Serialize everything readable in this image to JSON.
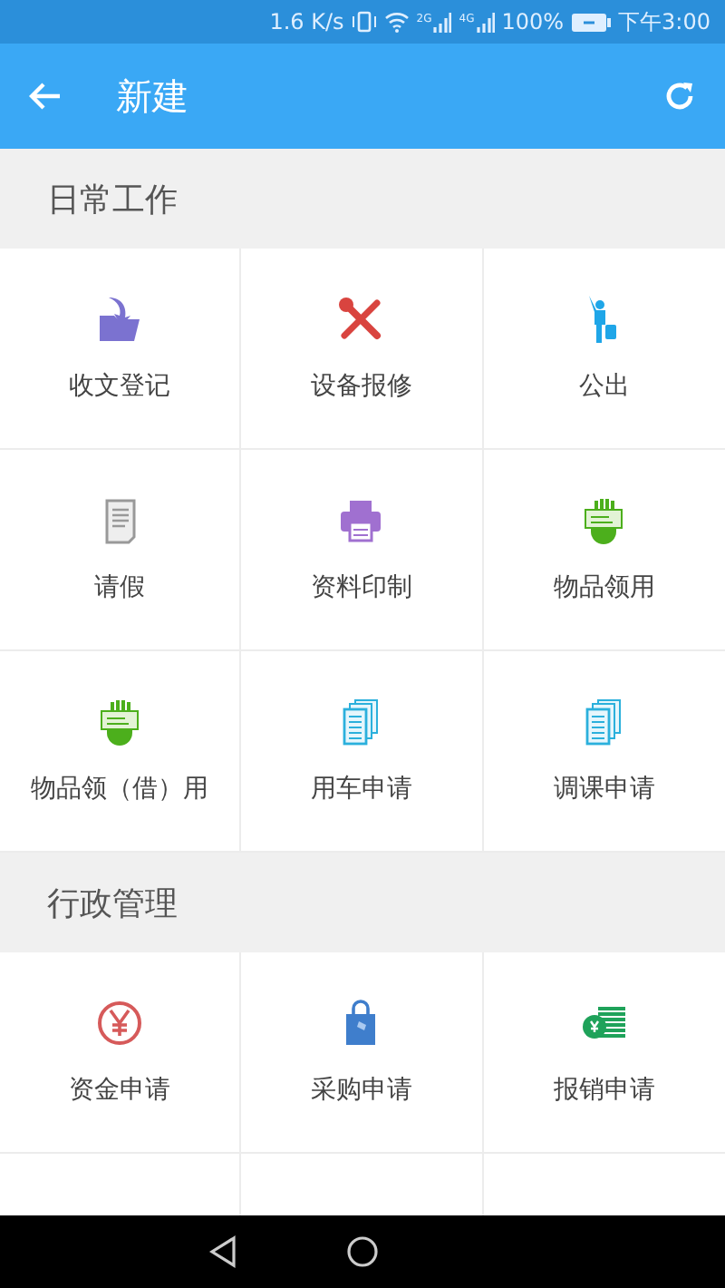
{
  "status_bar": {
    "speed": "1.6 K/s",
    "networks": [
      "2G",
      "4G"
    ],
    "battery": "100%",
    "time": "下午3:00"
  },
  "app_bar": {
    "title": "新建"
  },
  "sections": [
    {
      "title": "日常工作",
      "items": [
        {
          "label": "收文登记",
          "kind": "folder"
        },
        {
          "label": "设备报修",
          "kind": "tools"
        },
        {
          "label": "公出",
          "kind": "traveler"
        },
        {
          "label": "请假",
          "kind": "document"
        },
        {
          "label": "资料印制",
          "kind": "printer"
        },
        {
          "label": "物品领用",
          "kind": "hand"
        },
        {
          "label": "物品领（借）用",
          "kind": "hand"
        },
        {
          "label": "用车申请",
          "kind": "pages"
        },
        {
          "label": "调课申请",
          "kind": "pages"
        }
      ]
    },
    {
      "title": "行政管理",
      "items": [
        {
          "label": "资金申请",
          "kind": "yen"
        },
        {
          "label": "采购申请",
          "kind": "bag"
        },
        {
          "label": "报销申请",
          "kind": "coins"
        }
      ]
    }
  ]
}
